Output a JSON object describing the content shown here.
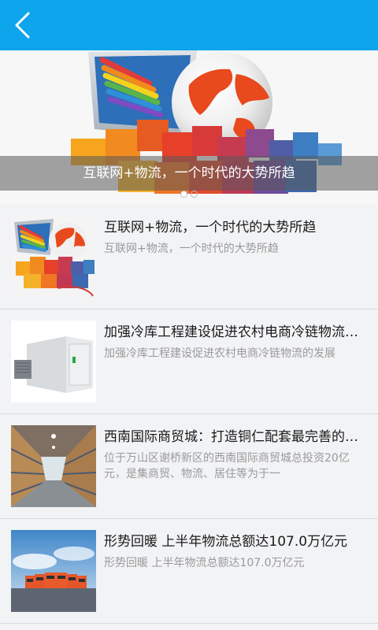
{
  "header": {
    "back_icon": "chevron-left-icon",
    "color": "#0ea5ec"
  },
  "banner": {
    "caption": "互联网+物流，一个时代的大势所趋",
    "dots_total": 2,
    "dots_active": 1
  },
  "news": [
    {
      "title": "互联网+物流，一个时代的大势所趋",
      "summary": "互联网+物流，一个时代的大势所趋"
    },
    {
      "title": "加强冷库工程建设促进农村电商冷链物流的发展",
      "summary": "加强冷库工程建设促进农村电商冷链物流的发展"
    },
    {
      "title": "西南国际商贸城：打造铜仁配套最完善的商贸物流城",
      "summary": "位于万山区谢桥新区的西南国际商贸城总投资20亿元，是集商贸、物流、居住等为于一"
    },
    {
      "title": "形势回暖 上半年物流总额达107.0万亿元",
      "summary": "形势回暖 上半年物流总额达107.0万亿元"
    }
  ]
}
